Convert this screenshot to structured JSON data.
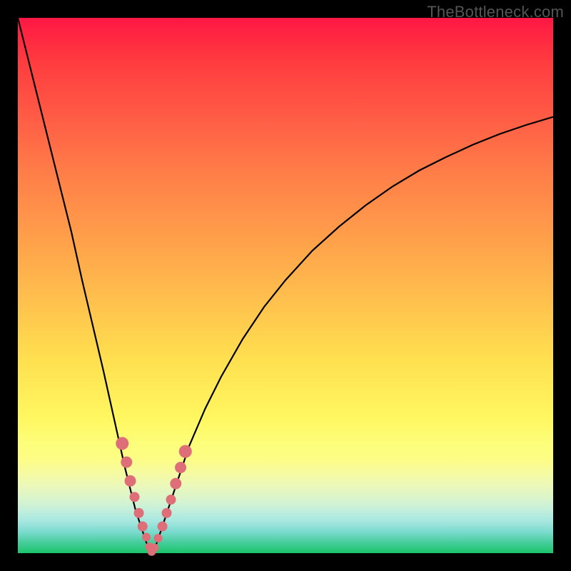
{
  "watermark": "TheBottleneck.com",
  "background": {
    "frame_color": "#000000",
    "gradient_stops": [
      {
        "pct": 0,
        "color": "#ff1744"
      },
      {
        "pct": 100,
        "color": "#1bc46a"
      }
    ]
  },
  "chart_data": {
    "type": "line",
    "title": "",
    "xlabel": "",
    "ylabel": "",
    "xlim": [
      0,
      100
    ],
    "ylim": [
      0,
      100
    ],
    "grid": false,
    "legend": false,
    "description": "Absolute deviation curve with a sharp V-shaped minimum. Values approach 0 at the optimum and rise toward 100 at the extremes.",
    "minimum_x": 25,
    "x": [
      0,
      2,
      4,
      6,
      8,
      10,
      12,
      14,
      16,
      18,
      20,
      21,
      22,
      23,
      24,
      25,
      26,
      27,
      28,
      30,
      32,
      35,
      38,
      42,
      46,
      50,
      55,
      60,
      65,
      70,
      75,
      80,
      85,
      90,
      95,
      100
    ],
    "y": [
      100,
      92,
      84,
      76,
      68,
      60,
      51,
      42.5,
      34,
      25,
      16,
      12,
      8,
      5,
      2,
      0,
      2,
      5,
      8,
      14,
      20,
      27,
      33,
      40,
      46,
      51,
      56.5,
      61,
      65,
      68.5,
      71.5,
      74,
      76.3,
      78.3,
      80,
      81.5
    ],
    "markers": {
      "note": "Highlighted sample points near the curve minimum, styled as pink beads.",
      "x": [
        19.5,
        20.3,
        21.0,
        21.8,
        22.6,
        23.3,
        24.0,
        24.6,
        25.0,
        25.5,
        26.2,
        27.0,
        27.8,
        28.6,
        29.5,
        30.4,
        31.3
      ],
      "y": [
        20.5,
        17.0,
        13.5,
        10.5,
        7.5,
        5.0,
        3.0,
        1.2,
        0.3,
        1.0,
        2.8,
        5.0,
        7.5,
        10.0,
        13.0,
        16.0,
        19.0
      ],
      "radius_px": [
        9,
        8,
        8,
        7,
        7,
        7,
        6,
        6,
        6,
        6,
        6,
        7,
        7,
        7,
        8,
        8,
        9
      ],
      "color": "#de6f78"
    }
  }
}
